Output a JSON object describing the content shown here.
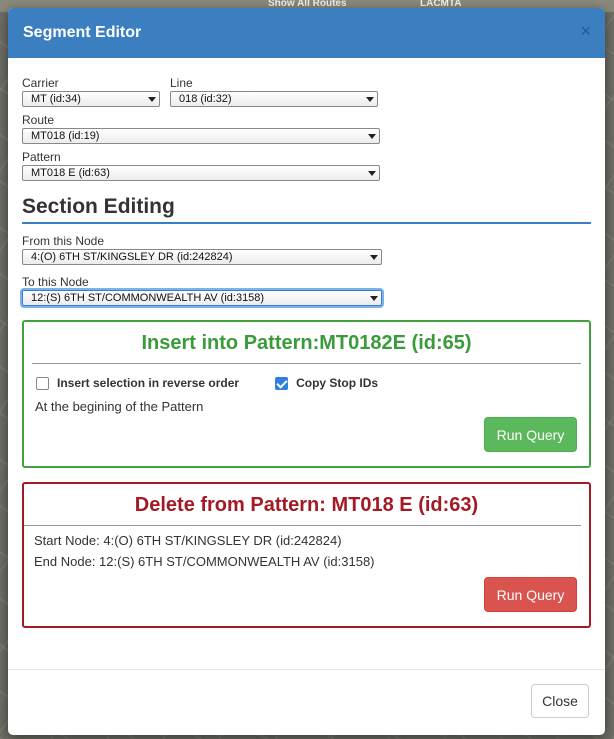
{
  "background": {
    "top_labels": [
      "Show All Routes",
      "LACMTA"
    ]
  },
  "modal": {
    "title": "Segment Editor",
    "close_icon": "×"
  },
  "fields": {
    "carrier": {
      "label": "Carrier",
      "value": "MT (id:34)"
    },
    "line": {
      "label": "Line",
      "value": "018 (id:32)"
    },
    "route": {
      "label": "Route",
      "value": "MT018 (id:19)"
    },
    "pattern": {
      "label": "Pattern",
      "value": "MT018 E (id:63)"
    }
  },
  "section": {
    "heading": "Section Editing",
    "from_node": {
      "label": "From this Node",
      "value": "4:(O) 6TH ST/KINGSLEY DR (id:242824)"
    },
    "to_node": {
      "label": "To this Node",
      "value": "12:(S) 6TH ST/COMMONWEALTH AV (id:3158)"
    }
  },
  "insert_panel": {
    "title": "Insert into Pattern:MT0182E (id:65)",
    "reverse_label": "Insert selection in reverse order",
    "reverse_checked": false,
    "copy_ids_label": "Copy Stop IDs",
    "copy_ids_checked": true,
    "position_text": "At the begining of the Pattern",
    "run_label": "Run Query"
  },
  "delete_panel": {
    "title": "Delete from Pattern: MT018 E (id:63)",
    "start_text": "Start Node: 4:(O) 6TH ST/KINGSLEY DR (id:242824)",
    "end_text": "End Node: 12:(S) 6TH ST/COMMONWEALTH AV (id:3158)",
    "run_label": "Run Query"
  },
  "footer": {
    "close_label": "Close"
  },
  "colors": {
    "header": "#3c7fc0",
    "insert_accent": "#3a9b3a",
    "delete_accent": "#a41a24",
    "run_green": "#5cb85c",
    "run_red": "#d9534f"
  }
}
